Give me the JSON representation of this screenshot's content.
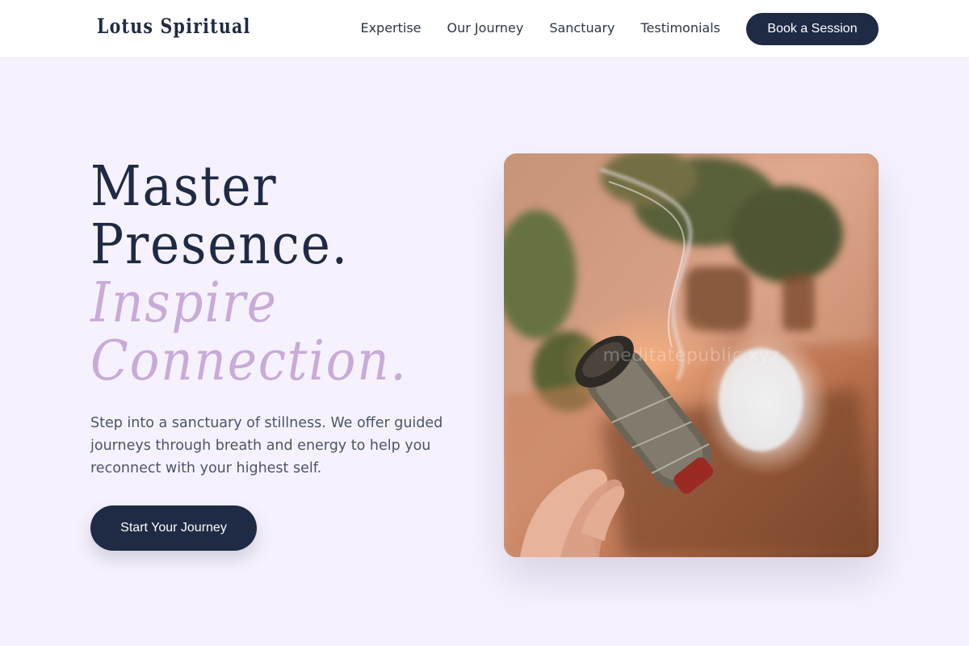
{
  "brand": "Lotus Spiritual",
  "nav": {
    "links": [
      "Expertise",
      "Our Journey",
      "Sanctuary",
      "Testimonials"
    ],
    "book_label": "Book a Session"
  },
  "hero": {
    "title_line1": "Master",
    "title_line2": "Presence.",
    "title_line3": "Inspire",
    "title_line4": "Connection.",
    "description": "Step into a sanctuary of stillness. We offer guided journeys through breath and energy to help you reconnect with your highest self.",
    "cta_label": "Start Your Journey",
    "image_watermark": "meditatepublic.xyz"
  },
  "colors": {
    "navy": "#1f2a44",
    "lavender_accent": "#c8abd9",
    "page_background": "#f6f2fd"
  },
  "image_subject": "hand-holding-smoking-sage-bundle-with-glowing-salt-lamp-and-plants"
}
